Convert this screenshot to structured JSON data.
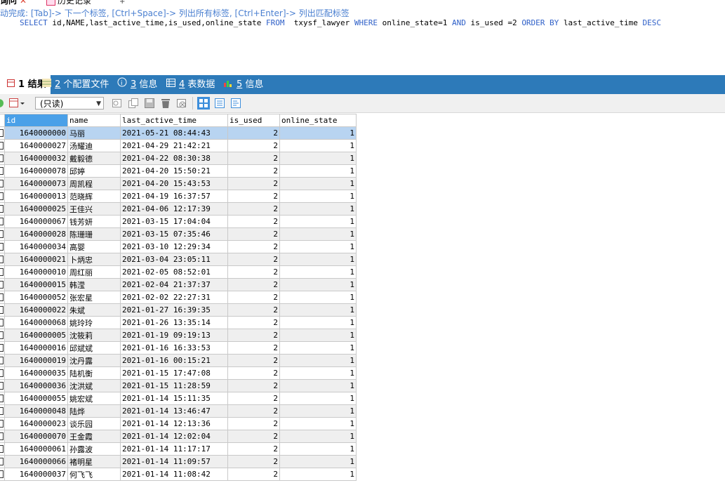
{
  "query_tabs": {
    "active_label": "询问",
    "history_label": "历史记录"
  },
  "hint": "动完成: [Tab]-> 下一个标签, [Ctrl+Space]-> 列出所有标签, [Ctrl+Enter]-> 列出匹配标签",
  "sql": {
    "kw_select": "SELECT",
    "cols": " id,NAME,last_active_time,is_used,online_state ",
    "kw_from": "FROM",
    "table": "  txysf_lawyer ",
    "kw_where": "WHERE",
    "cond1": " online_state=1 ",
    "kw_and": "AND",
    "cond2": " is_used =2 ",
    "kw_order": "ORDER BY",
    "order_col": " last_active_time ",
    "kw_desc": "DESC"
  },
  "result_tabs": [
    {
      "num": "1",
      "label": " 结果"
    },
    {
      "num": "2",
      "label": " 个配置文件"
    },
    {
      "num": "3",
      "label": " 信息"
    },
    {
      "num": "4",
      "label": " 表数据"
    },
    {
      "num": "5",
      "label": " 信息"
    }
  ],
  "toolbar": {
    "mode_select": "(只读)"
  },
  "columns": [
    "id",
    "name",
    "last_active_time",
    "is_used",
    "online_state"
  ],
  "rows": [
    [
      "1640000000",
      "马丽",
      "2021-05-21 08:44:43",
      "2",
      "1"
    ],
    [
      "1640000027",
      "汤耀迪",
      "2021-04-29 21:42:21",
      "2",
      "1"
    ],
    [
      "1640000032",
      "戴毅德",
      "2021-04-22 08:30:38",
      "2",
      "1"
    ],
    [
      "1640000078",
      "邱婷",
      "2021-04-20 15:50:21",
      "2",
      "1"
    ],
    [
      "1640000073",
      "周凯程",
      "2021-04-20 15:43:53",
      "2",
      "1"
    ],
    [
      "1640000013",
      "范晓辉",
      "2021-04-19 16:37:57",
      "2",
      "1"
    ],
    [
      "1640000025",
      "王佳兴",
      "2021-04-06 12:17:39",
      "2",
      "1"
    ],
    [
      "1640000067",
      "钱芳妍",
      "2021-03-15 17:04:04",
      "2",
      "1"
    ],
    [
      "1640000028",
      "陈珊珊",
      "2021-03-15 07:35:46",
      "2",
      "1"
    ],
    [
      "1640000034",
      "高婴",
      "2021-03-10 12:29:34",
      "2",
      "1"
    ],
    [
      "1640000021",
      "卜炳忠",
      "2021-03-04 23:05:11",
      "2",
      "1"
    ],
    [
      "1640000010",
      "周红丽",
      "2021-02-05 08:52:01",
      "2",
      "1"
    ],
    [
      "1640000015",
      "韩滢",
      "2021-02-04 21:37:37",
      "2",
      "1"
    ],
    [
      "1640000052",
      "张宏星",
      "2021-02-02 22:27:31",
      "2",
      "1"
    ],
    [
      "1640000022",
      "朱斌",
      "2021-01-27 16:39:35",
      "2",
      "1"
    ],
    [
      "1640000068",
      "姚玲玲",
      "2021-01-26 13:35:14",
      "2",
      "1"
    ],
    [
      "1640000005",
      "沈筱莉",
      "2021-01-19 09:19:13",
      "2",
      "1"
    ],
    [
      "1640000016",
      "邱斌斌",
      "2021-01-16 16:33:53",
      "2",
      "1"
    ],
    [
      "1640000019",
      "沈丹露",
      "2021-01-16 00:15:21",
      "2",
      "1"
    ],
    [
      "1640000035",
      "陆机衡",
      "2021-01-15 17:47:08",
      "2",
      "1"
    ],
    [
      "1640000036",
      "沈洪斌",
      "2021-01-15 11:28:59",
      "2",
      "1"
    ],
    [
      "1640000055",
      "姚宏斌",
      "2021-01-14 15:11:35",
      "2",
      "1"
    ],
    [
      "1640000048",
      "陆烨",
      "2021-01-14 13:46:47",
      "2",
      "1"
    ],
    [
      "1640000023",
      "谈乐园",
      "2021-01-14 12:13:36",
      "2",
      "1"
    ],
    [
      "1640000070",
      "王金霞",
      "2021-01-14 12:02:04",
      "2",
      "1"
    ],
    [
      "1640000061",
      "孙露波",
      "2021-01-14 11:17:17",
      "2",
      "1"
    ],
    [
      "1640000066",
      "褚明星",
      "2021-01-14 11:09:57",
      "2",
      "1"
    ],
    [
      "1640000037",
      "何飞飞",
      "2021-01-14 11:08:42",
      "2",
      "1"
    ]
  ],
  "colors": {
    "tab_bar": "#2d7ab9",
    "selected_row": "#b8d4f1",
    "id_header": "#4aa0e8",
    "keyword": "#2f60c8",
    "hint": "#4a7fd0"
  }
}
